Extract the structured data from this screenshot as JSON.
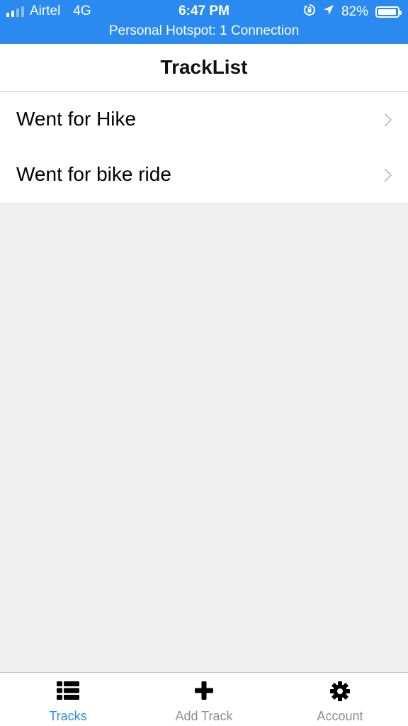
{
  "status_bar": {
    "carrier": "Airtel",
    "network": "4G",
    "time": "6:47 PM",
    "battery_percent": "82%",
    "battery_level": 0.82,
    "hotspot": "Personal Hotspot: 1 Connection",
    "background_color": "#2b8af0",
    "icons": [
      "signal-icon",
      "orientation-lock-icon",
      "location-arrow-icon",
      "battery-icon"
    ]
  },
  "nav": {
    "title": "TrackList"
  },
  "tracks": [
    {
      "label": "Went for Hike",
      "icon": "chevron-right-icon"
    },
    {
      "label": "Went for bike ride",
      "icon": "chevron-right-icon"
    }
  ],
  "tab_bar": {
    "accent_color": "#2b8af0",
    "inactive_color": "#8e8e8e",
    "tabs": [
      {
        "label": "Tracks",
        "icon": "list-icon",
        "active": true
      },
      {
        "label": "Add Track",
        "icon": "plus-icon",
        "active": false
      },
      {
        "label": "Account",
        "icon": "gear-icon",
        "active": false
      }
    ]
  }
}
